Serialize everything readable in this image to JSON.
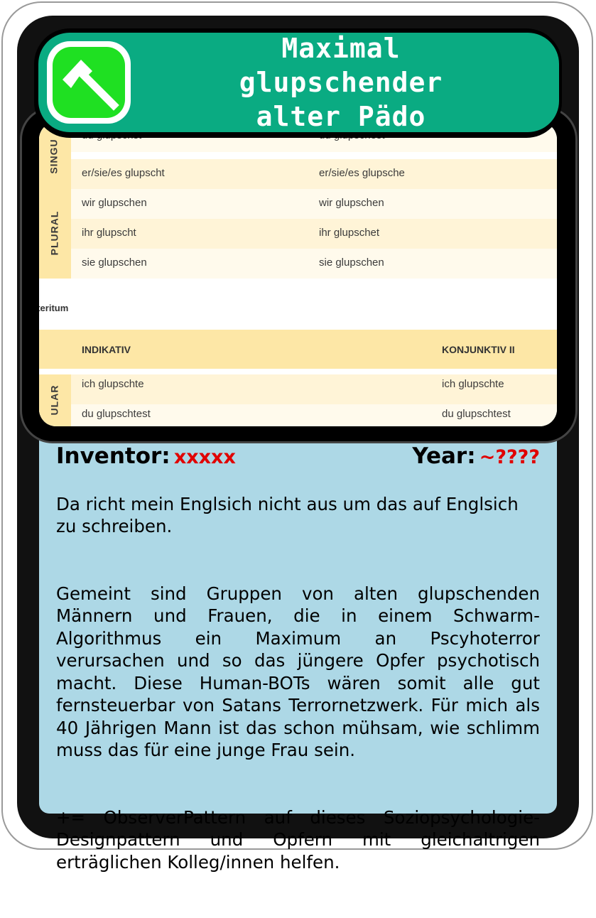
{
  "card": {
    "title_lines": [
      "Maximal",
      "glupschender",
      "alter Pädo"
    ],
    "icon": "hammer-icon",
    "colors": {
      "title_bg": "#0aab82",
      "icon_bg": "#1fe022",
      "panel_bg": "#add8e6",
      "value_color": "#e00000"
    }
  },
  "image": {
    "singular_label": "SINGU",
    "plural_label": "PLURAL",
    "singular_label_2": "ULAR",
    "top_rows": [
      {
        "left": "du glupschst",
        "right": "du glupschest"
      },
      {
        "left": "er/sie/es glupscht",
        "right": "er/sie/es glupsche"
      },
      {
        "left": "wir glupschen",
        "right": "wir glupschen"
      },
      {
        "left": "ihr glupscht",
        "right": "ihr glupschet"
      },
      {
        "left": "sie glupschen",
        "right": "sie glupschen"
      }
    ],
    "section_title": "äteritum",
    "headers": {
      "left": "INDIKATIV",
      "right": "KONJUNKTIV II"
    },
    "bottom_rows": [
      {
        "left": "ich glupschte",
        "right": "ich glupschte"
      },
      {
        "left": "du glupschtest",
        "right": "du glupschtest"
      }
    ]
  },
  "info": {
    "inventor_label": "Inventor:",
    "inventor_value": "xxxxx",
    "year_label": "Year:",
    "year_value": "~????"
  },
  "description": {
    "p1": "Da richt mein Englsich nicht aus um das auf Englsich zu schreiben.",
    "p2": "Gemeint sind Gruppen von alten glupschenden Männern und Frauen, die in einem Schwarm-Algorithmus ein Maximum an Pscyhoterror verursachen und so das jüngere Opfer psychotisch macht. Diese Human-BOTs wären somit alle gut fernsteuerbar von Satans Terrornetzwerk. Für mich als 40 Jährigen Mann ist das schon mühsam, wie schlimm muss das für eine junge Frau sein.",
    "p3": "+= ObserverPattern auf dieses Soziopsychologie-Designpattern und Opfern mit gleichaltrigen erträglichen Kolleg/innen helfen."
  }
}
